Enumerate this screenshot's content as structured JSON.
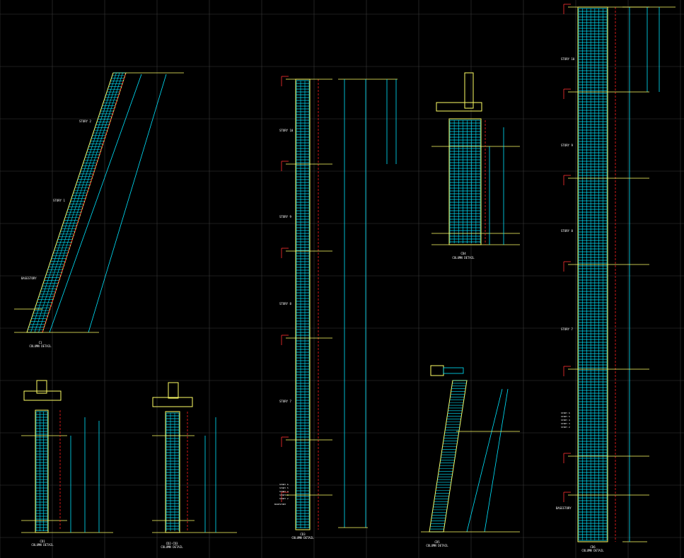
{
  "colors": {
    "background": "#000000",
    "grid": "#3a3a3a",
    "column_outline": "#ffff66",
    "rebar": "#00e5ff",
    "dimension": "#ff2020",
    "annotation": "#ffff00",
    "text": "#ffffff",
    "level_marker": "#ff3030"
  },
  "details": [
    {
      "id": "slanted-column-detail",
      "caption_line1": "C1",
      "caption_line2": "COLUMN DETAIL",
      "stories": [
        "STORY 2",
        "STORY 1",
        "BASESTORY"
      ]
    },
    {
      "id": "column-detail-cd1",
      "caption_line1": "CD1",
      "caption_line2": "COLUMN DETAIL"
    },
    {
      "id": "column-detail-cd2-cd3",
      "caption_line1": "CD2-CD3",
      "caption_line2": "COLUMN DETAIL"
    },
    {
      "id": "tall-column-detail-center",
      "caption_line1": "CD3",
      "caption_line2": "COLUMN DETAIL",
      "stories": [
        "STORY 10",
        "STORY 9",
        "STORY 8",
        "STORY 7",
        "STORY 6",
        "STORY 5",
        "STORY 4",
        "STORY 3",
        "STORY 2",
        "BASESTORY"
      ]
    },
    {
      "id": "column-detail-cd4",
      "caption_line1": "CD4",
      "caption_line2": "COLUMN DETAIL"
    },
    {
      "id": "column-detail-cd5",
      "caption_line1": "CD5",
      "caption_line2": "COLUMN DETAIL"
    },
    {
      "id": "tall-column-detail-right",
      "caption_line1": "CD6",
      "caption_line2": "COLUMN DETAIL",
      "stories": [
        "STORY 10",
        "STORY 9",
        "STORY 8",
        "STORY 7",
        "STORY 6",
        "STORY 5",
        "STORY 4",
        "STORY 3",
        "STORY 2",
        "BASESTORY"
      ]
    }
  ]
}
